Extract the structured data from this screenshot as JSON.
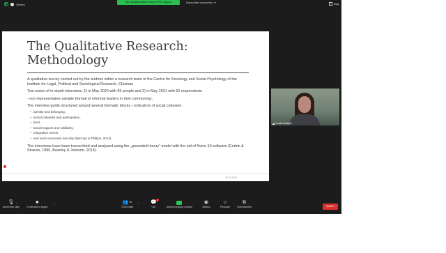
{
  "topbar": {
    "recording_label": "Запись",
    "share_banner": "Вы просматриваете экран Petru Negura",
    "view_options": "Настройки просмотра",
    "view_label": "Вид"
  },
  "slide": {
    "title_line1": "The Qualitative Research:",
    "title_line2": "Methodology",
    "paragraphs": [
      "A qualitative survey carried out by the authors within a research team of the Centre for Sociology and Social Psychology of the Institute for Legal, Political and Sociological Research, Chisinau",
      "Two series of in-depth interviews, 1) in May 2020 with 95 people and 2) in May 2021 with 52 respondents.",
      "- non-representative sample (formal or informal leaders in their community);",
      "The interview guide structured around several thematic blocks – indicators of social cohesion:",
      "The interviews have been transcribed and analysed using the „grounded theory” model with the aid of Nvivo-10 software (Corbin & Strauss, 1990, Bazeley & Jackson, 2013)."
    ],
    "bullets": [
      "identity and belonging,",
      "social networks and participation,",
      "trust,",
      "social support and solidarity,",
      "integrative norms",
      "and socio-economic security (Berman & Phillips, 2012)."
    ],
    "footer_date": "24.11.2021"
  },
  "video": {
    "participant_name": "Lucia Gasper"
  },
  "toolbar": {
    "unmute": "Включить звук",
    "start_video": "Остановить видео",
    "participants": "Участники",
    "participants_count": "35",
    "chat": "Чат",
    "chat_badge": "1",
    "share_screen": "Демонстрация экрана",
    "record": "Запись",
    "reactions": "Реакции",
    "apps": "Приложения",
    "end": "Выйти"
  },
  "colors": {
    "window_bg": "#1c1c1c",
    "accent_green": "#2bbd4f",
    "end_red": "#dc2f2f"
  }
}
